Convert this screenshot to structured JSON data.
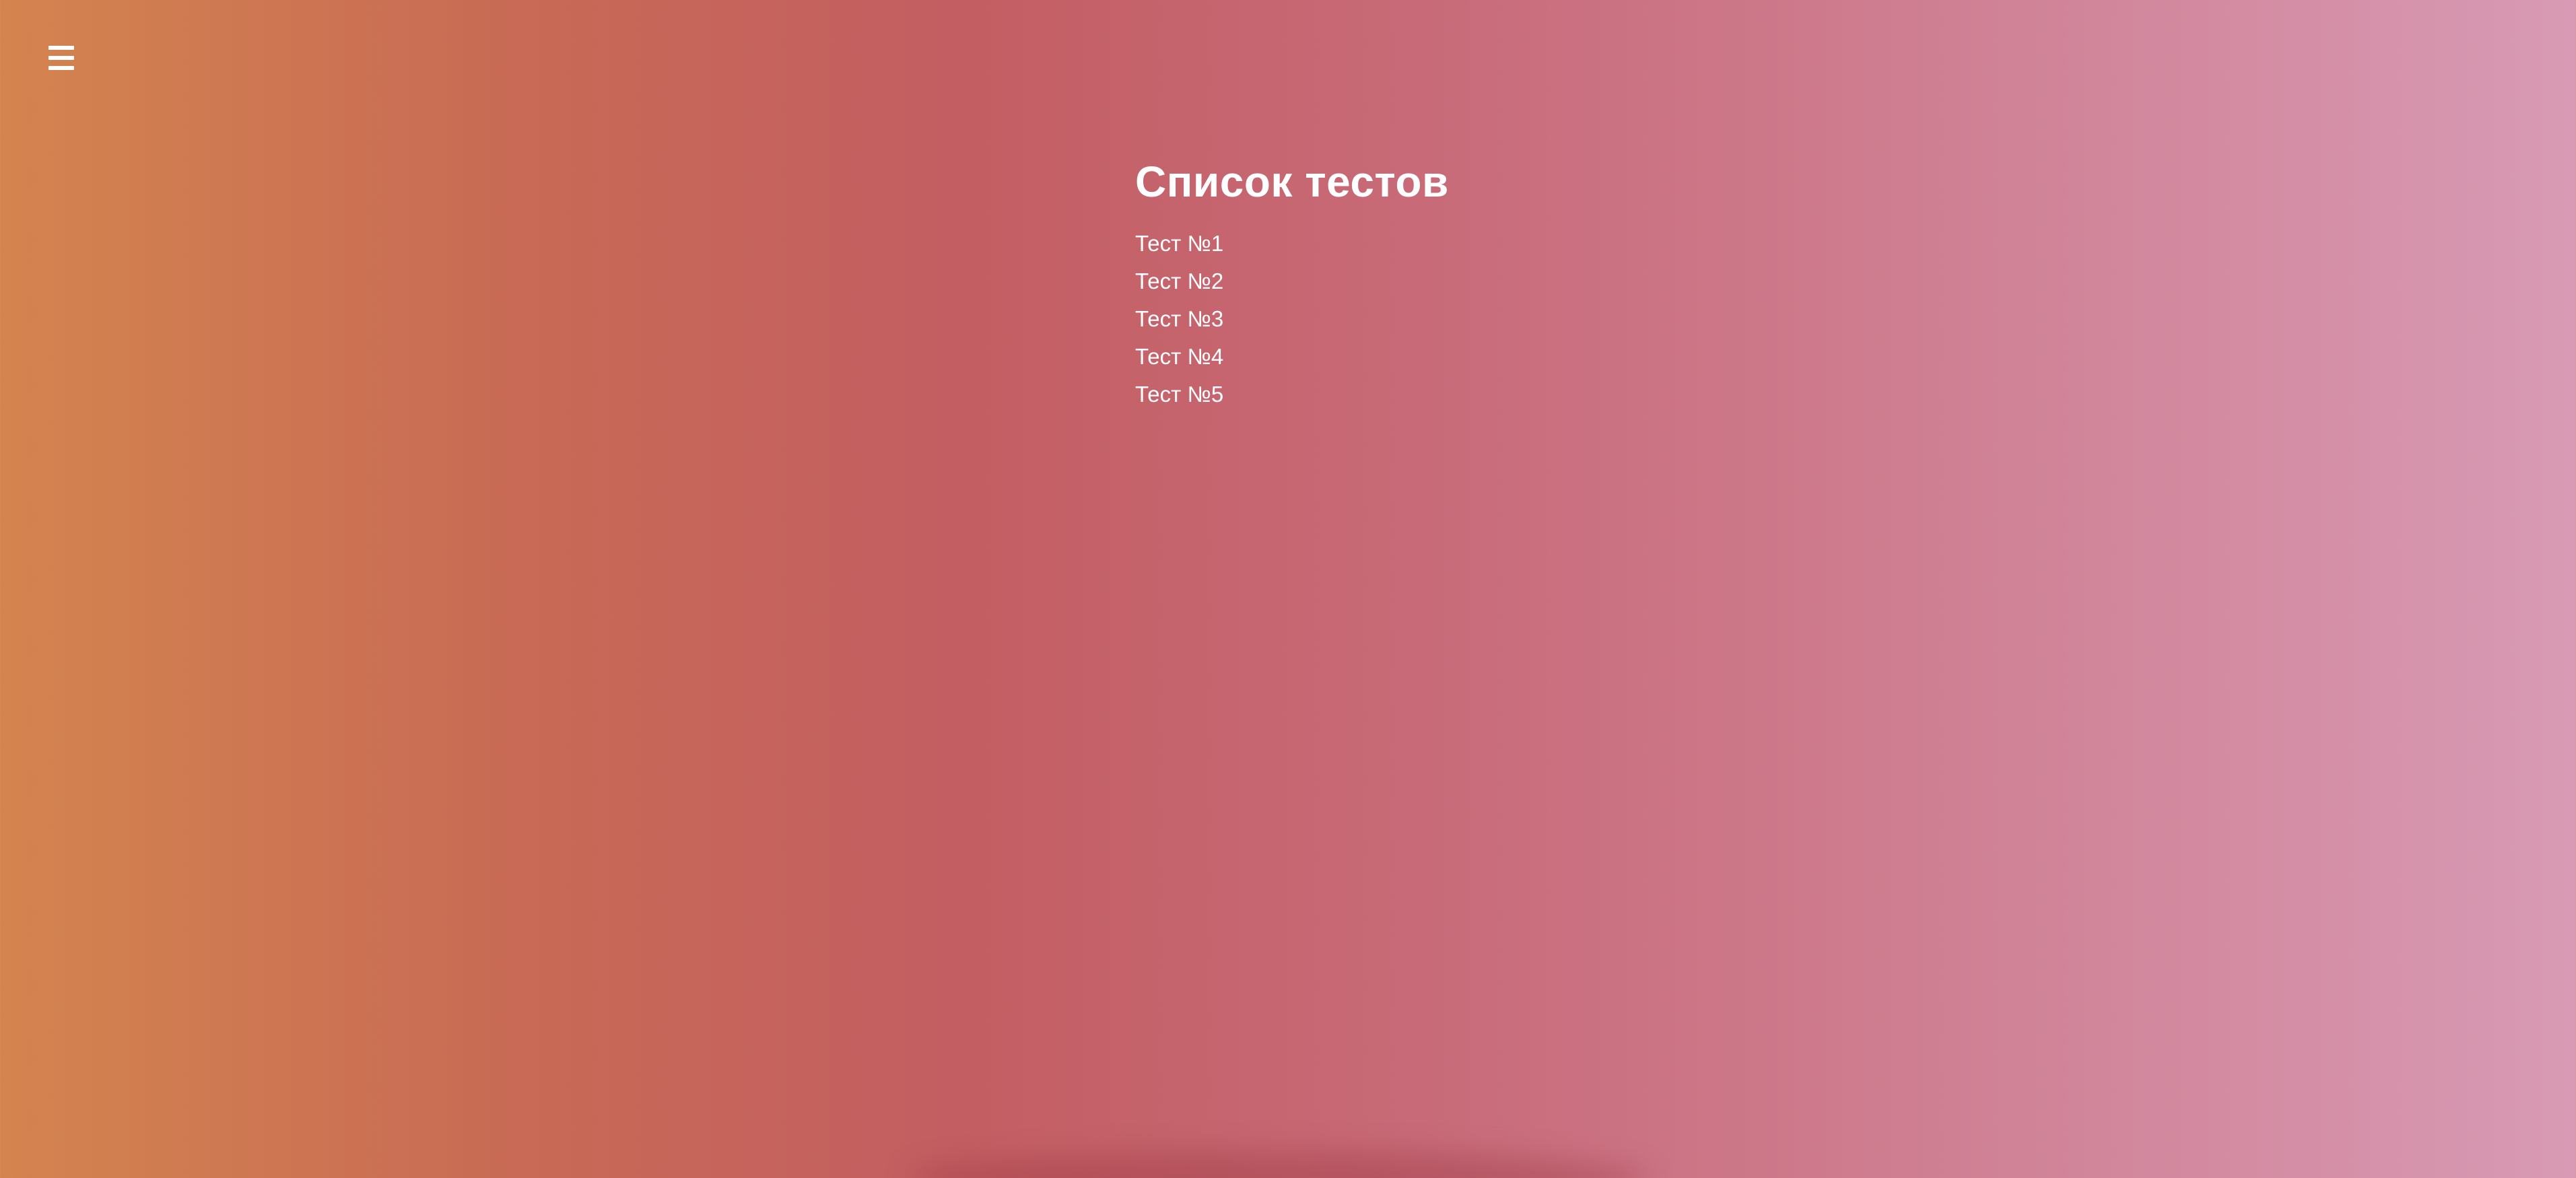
{
  "header": {
    "menu_icon": "hamburger-menu-icon"
  },
  "main": {
    "title": "Список тестов",
    "tests": [
      {
        "label": "Тест №1"
      },
      {
        "label": "Тест №2"
      },
      {
        "label": "Тест №3"
      },
      {
        "label": "Тест №4"
      },
      {
        "label": "Тест №5"
      }
    ]
  },
  "colors": {
    "gradient_left": "#d4844f",
    "gradient_mid": "#c35e62",
    "gradient_right": "#d89ab4",
    "text": "#ffffff"
  }
}
